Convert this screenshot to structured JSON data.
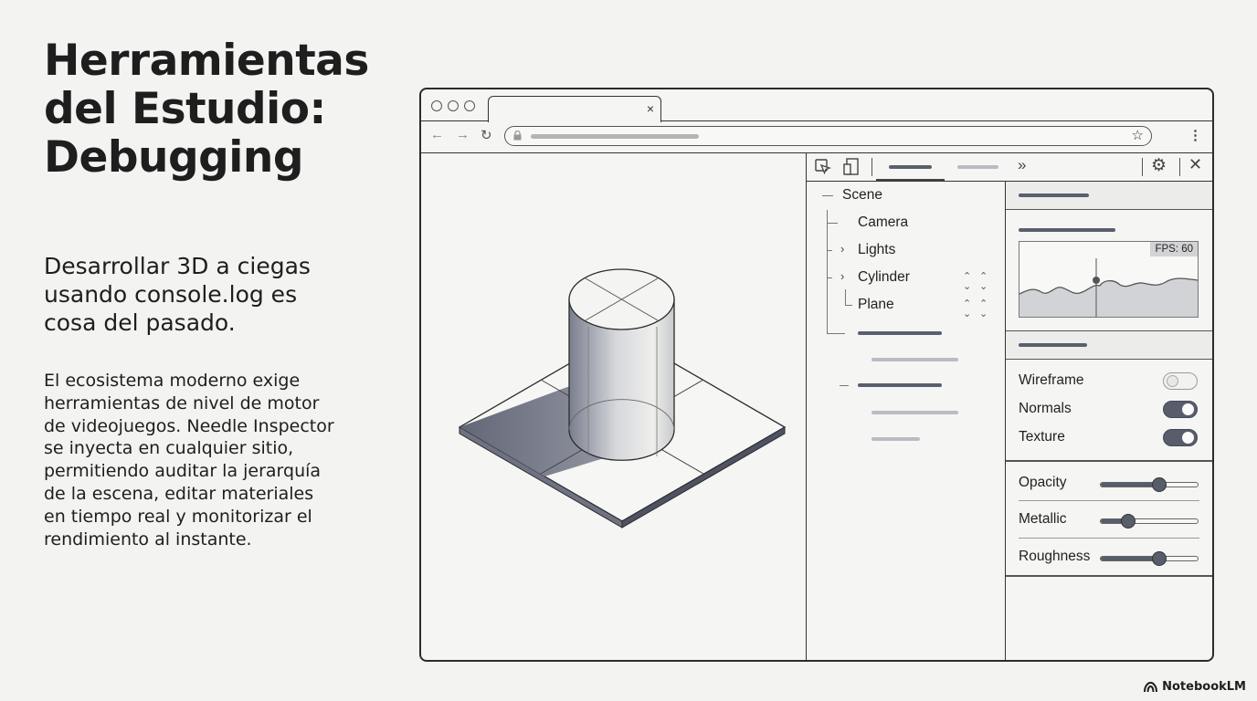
{
  "slide": {
    "title": "Herramientas del Estudio: Debugging",
    "lead": "Desarrollar 3D a ciegas usando console.log es cosa del pasado.",
    "body": "El ecosistema moderno exige herramientas de nivel de motor de videojuegos. Needle Inspector se inyecta en cualquier sitio, permitiendo auditar la jerarquía de la escena, editar materiales en tiempo real y monitorizar el rendimiento al instante.",
    "brand": "NotebookLM"
  },
  "browser": {
    "tab_close": "×",
    "icons": [
      "back-arrow-icon",
      "forward-arrow-icon",
      "reload-icon",
      "lock-icon",
      "star-icon",
      "kebab-menu-icon"
    ]
  },
  "devtools": {
    "toolbar_icons": [
      "cursor-select-icon",
      "device-toggle-icon",
      "more-tabs-icon",
      "gear-icon",
      "close-icon"
    ],
    "tree": {
      "root": "Scene",
      "items": [
        "Camera",
        "Lights",
        "Cylinder",
        "Plane"
      ]
    },
    "fps_label": "FPS: 60",
    "toggles": [
      {
        "label": "Wireframe",
        "on": false
      },
      {
        "label": "Normals",
        "on": true
      },
      {
        "label": "Texture",
        "on": true
      }
    ],
    "sliders": [
      {
        "label": "Opacity",
        "value": 0.6
      },
      {
        "label": "Metallic",
        "value": 0.28
      },
      {
        "label": "Roughness",
        "value": 0.6
      }
    ]
  },
  "colors": {
    "accent": "#585d6c",
    "background": "#f3f3f1",
    "text": "#1e1e1e"
  }
}
